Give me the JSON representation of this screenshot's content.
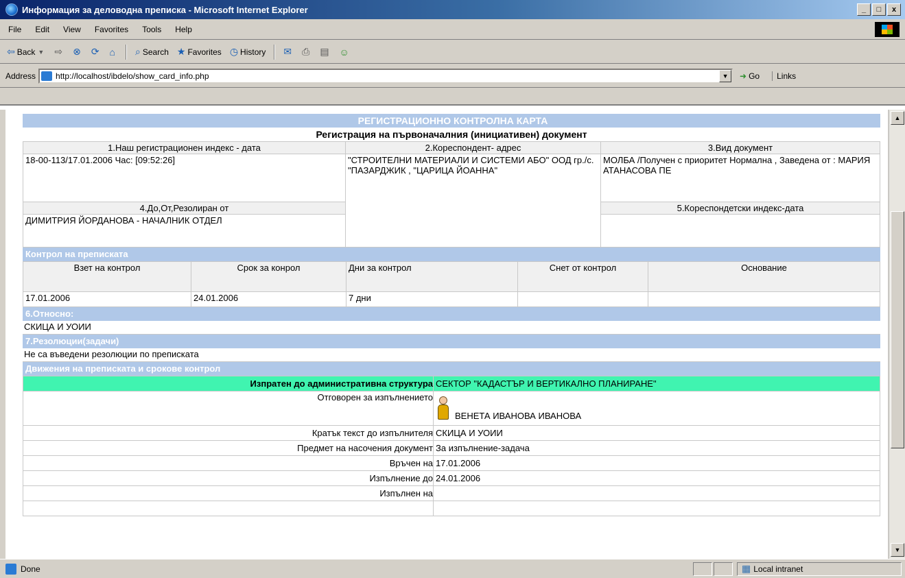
{
  "window": {
    "title": "Информация за деловодна преписка - Microsoft Internet Explorer",
    "minimize": "_",
    "maximize": "□",
    "close": "x"
  },
  "menu": [
    "File",
    "Edit",
    "View",
    "Favorites",
    "Tools",
    "Help"
  ],
  "toolbar": {
    "back": "Back",
    "search": "Search",
    "favorites": "Favorites",
    "history": "History"
  },
  "address": {
    "label": "Address",
    "url": "http://localhost/ibdelo/show_card_info.php",
    "go": "Go",
    "links": "Links"
  },
  "card": {
    "title": "РЕГИСТРАЦИОННО КОНТРОЛНА КАРТА",
    "subtitle": "Регистрация на първоначалния (инициативен) документ",
    "h1": "1.Наш регистрационен индекс - дата",
    "v1": "18-00-113/17.01.2006 Час: [09:52:26]",
    "h2": "2.Кореспондент- адрес",
    "v2": "\"СТРОИТЕЛНИ МАТЕРИАЛИ И СИСТЕМИ АБО\" ООД гр./с. \"ПАЗАРДЖИК , \"ЦАРИЦА ЙОАННА\"",
    "h3": "3.Вид документ",
    "v3": "МОЛБА /Получен с приоритет Нормална , Заведена от : МАРИЯ АТАНАСОВА ПЕ",
    "h4": "4.До,От,Резолиран от",
    "v4": "ДИМИТРИЯ ЙОРДАНОВА - НАЧАЛНИК ОТДЕЛ",
    "h5": "5.Кореспондетски индекс-дата",
    "v5": ""
  },
  "control": {
    "band": "Контрол на преписката",
    "headers": [
      "Взет на контрол",
      "Срок за конрол",
      "Дни за контрол",
      "Снет от контрол",
      "Основание"
    ],
    "values": [
      "17.01.2006",
      "24.01.2006",
      "7 дни",
      "",
      ""
    ]
  },
  "regarding": {
    "band": "6.Относно:",
    "text": "СКИЦА И УОИИ"
  },
  "resolutions": {
    "band": "7.Резолюции(задачи)",
    "text": "Не са въведени резолюции по преписката"
  },
  "movement": {
    "band": "Движения на преписката и срокове контрол",
    "sent_label": "Изпратен до административна структура",
    "sent_value": "СЕКТОР \"КАДАСТЪР И ВЕРТИКАЛНО ПЛАНИРАНЕ\"",
    "responsible_label": "Отговорен за изпълнението",
    "responsible_value": "ВЕНЕТА ИВАНОВА ИВАНОВА",
    "short_text_label": "Кратък текст до изпълнителя",
    "short_text_value": "СКИЦА И УОИИ",
    "subject_label": "Предмет на насочения документ",
    "subject_value": "За изпълнение-задача",
    "delivered_label": "Връчен на",
    "delivered_value": "17.01.2006",
    "due_label": "Изпълнение до",
    "due_value": "24.01.2006",
    "done_label": "Изпълнен на",
    "done_value": ""
  },
  "status": {
    "text": "Done",
    "zone": "Local intranet"
  }
}
